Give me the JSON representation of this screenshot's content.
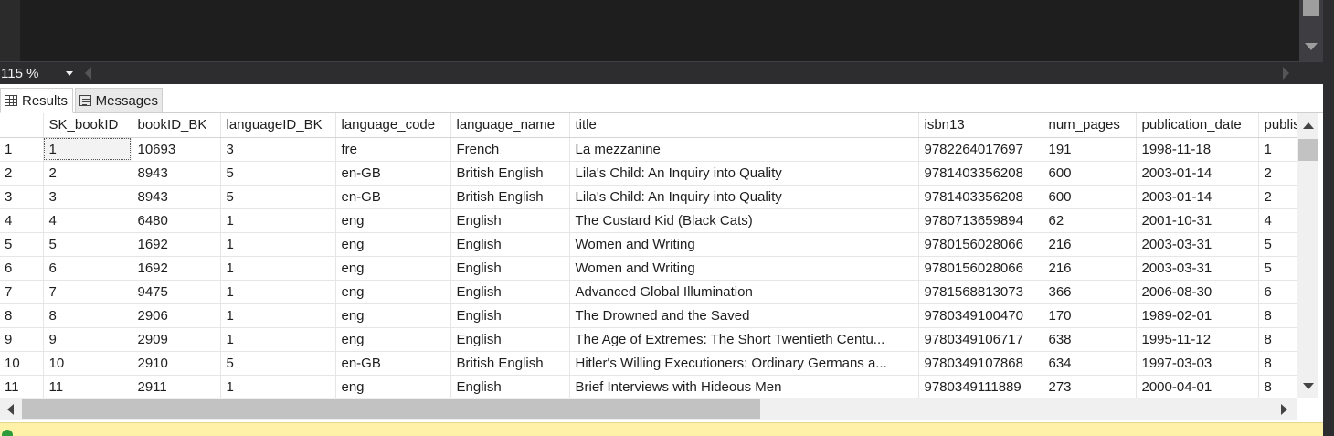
{
  "zoom": {
    "value": "115 %"
  },
  "tabs": [
    {
      "label": "Results",
      "icon": "grid-icon",
      "active": true
    },
    {
      "label": "Messages",
      "icon": "messages-icon",
      "active": false
    }
  ],
  "grid": {
    "columns": [
      "",
      "SK_bookID",
      "bookID_BK",
      "languageID_BK",
      "language_code",
      "language_name",
      "title",
      "isbn13",
      "num_pages",
      "publication_date",
      "publis"
    ],
    "rows": [
      [
        "1",
        "1",
        "10693",
        "3",
        "fre",
        "French",
        "La mezzanine",
        "9782264017697",
        "191",
        "1998-11-18",
        "1"
      ],
      [
        "2",
        "2",
        "8943",
        "5",
        "en-GB",
        "British English",
        "Lila's Child: An Inquiry into Quality",
        "9781403356208",
        "600",
        "2003-01-14",
        "2"
      ],
      [
        "3",
        "3",
        "8943",
        "5",
        "en-GB",
        "British English",
        "Lila's Child: An Inquiry into Quality",
        "9781403356208",
        "600",
        "2003-01-14",
        "2"
      ],
      [
        "4",
        "4",
        "6480",
        "1",
        "eng",
        "English",
        "The Custard Kid (Black Cats)",
        "9780713659894",
        "62",
        "2001-10-31",
        "4"
      ],
      [
        "5",
        "5",
        "1692",
        "1",
        "eng",
        "English",
        "Women and Writing",
        "9780156028066",
        "216",
        "2003-03-31",
        "5"
      ],
      [
        "6",
        "6",
        "1692",
        "1",
        "eng",
        "English",
        "Women and Writing",
        "9780156028066",
        "216",
        "2003-03-31",
        "5"
      ],
      [
        "7",
        "7",
        "9475",
        "1",
        "eng",
        "English",
        "Advanced Global Illumination",
        "9781568813073",
        "366",
        "2006-08-30",
        "6"
      ],
      [
        "8",
        "8",
        "2906",
        "1",
        "eng",
        "English",
        "The Drowned and the Saved",
        "9780349100470",
        "170",
        "1989-02-01",
        "8"
      ],
      [
        "9",
        "9",
        "2909",
        "1",
        "eng",
        "English",
        "The Age of Extremes: The Short Twentieth Centu...",
        "9780349106717",
        "638",
        "1995-11-12",
        "8"
      ],
      [
        "10",
        "10",
        "2910",
        "5",
        "en-GB",
        "British English",
        "Hitler's Willing Executioners: Ordinary Germans a...",
        "9780349107868",
        "634",
        "1997-03-03",
        "8"
      ],
      [
        "11",
        "11",
        "2911",
        "1",
        "eng",
        "English",
        "Brief Interviews with Hideous Men",
        "9780349111889",
        "273",
        "2000-04-01",
        "8"
      ]
    ]
  }
}
